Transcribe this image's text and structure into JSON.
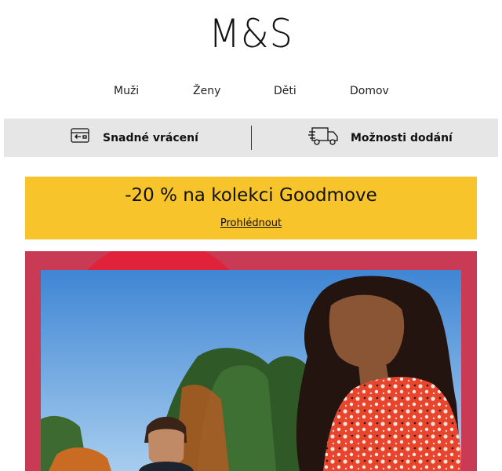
{
  "brand": {
    "logo_text": "M&S"
  },
  "nav": {
    "items": [
      {
        "label": "Muži"
      },
      {
        "label": "Ženy"
      },
      {
        "label": "Děti"
      },
      {
        "label": "Domov"
      }
    ]
  },
  "service_bar": {
    "returns": {
      "label": "Snadné vrácení",
      "icon": "return-card-icon"
    },
    "delivery": {
      "label": "Možnosti dodání",
      "icon": "delivery-truck-icon"
    }
  },
  "promo": {
    "title": "-20 % na kolekci Goodmove",
    "link_label": "Prohlédnout",
    "background": "#f8c42b"
  },
  "hero": {
    "frame_color": "#c93a55",
    "image": "people-in-nature-photo"
  }
}
